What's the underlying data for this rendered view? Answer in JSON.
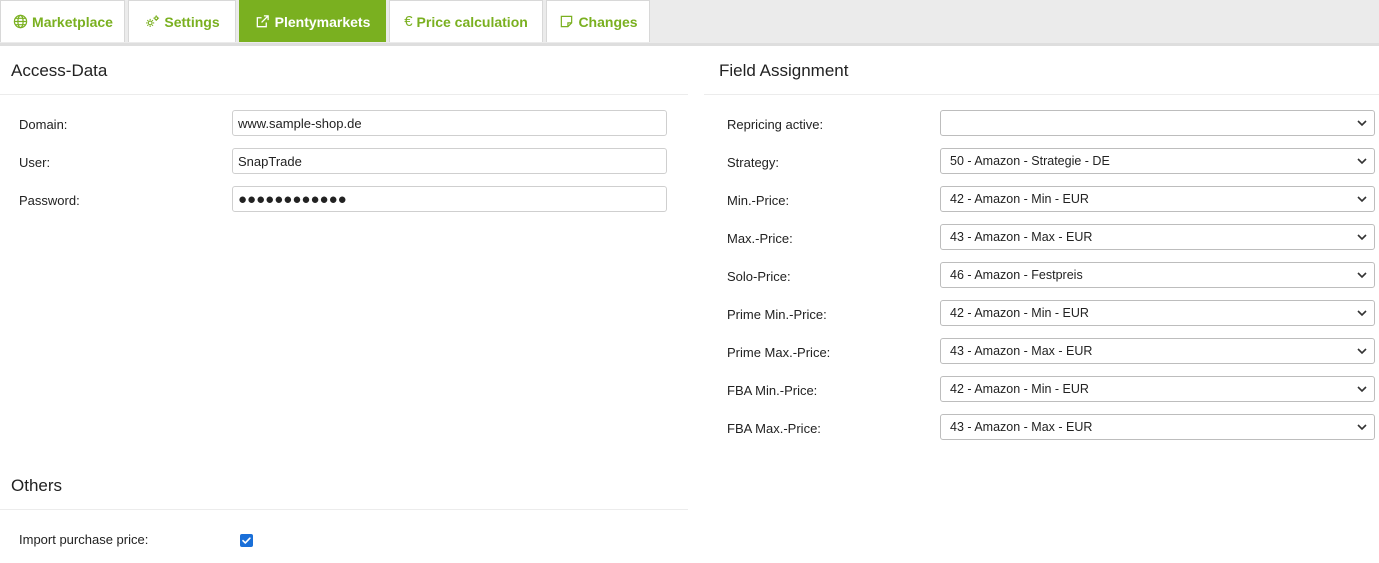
{
  "tabs": [
    {
      "label": "Marketplace",
      "icon": "globe-icon"
    },
    {
      "label": "Settings",
      "icon": "gears-icon"
    },
    {
      "label": "Plentymarkets",
      "icon": "external-link-icon",
      "active": true
    },
    {
      "label": "Price calculation",
      "icon": "euro-icon",
      "symbol": "€"
    },
    {
      "label": "Changes",
      "icon": "note-icon"
    }
  ],
  "access_data": {
    "title": "Access-Data",
    "domain_label": "Domain:",
    "domain_value": "www.sample-shop.de",
    "user_label": "User:",
    "user_value": "SnapTrade",
    "password_label": "Password:",
    "password_value": "●●●●●●●●●●●●"
  },
  "others": {
    "title": "Others",
    "import_purchase_price_label": "Import purchase price:",
    "import_purchase_price_checked": true
  },
  "field_assignment": {
    "title": "Field Assignment",
    "rows": [
      {
        "label": "Repricing active:",
        "value": ""
      },
      {
        "label": "Strategy:",
        "value": "50 - Amazon - Strategie - DE"
      },
      {
        "label": "Min.-Price:",
        "value": "42 - Amazon - Min - EUR"
      },
      {
        "label": "Max.-Price:",
        "value": "43 - Amazon - Max - EUR"
      },
      {
        "label": "Solo-Price:",
        "value": "46 - Amazon - Festpreis"
      },
      {
        "label": "Prime Min.-Price:",
        "value": "42 - Amazon - Min - EUR"
      },
      {
        "label": "Prime Max.-Price:",
        "value": "43 - Amazon - Max - EUR"
      },
      {
        "label": "FBA Min.-Price:",
        "value": "42 - Amazon - Min - EUR"
      },
      {
        "label": "FBA Max.-Price:",
        "value": "43 - Amazon - Max - EUR"
      }
    ]
  },
  "colors": {
    "accent": "#7ab020",
    "checkbox": "#1a6fd8"
  }
}
